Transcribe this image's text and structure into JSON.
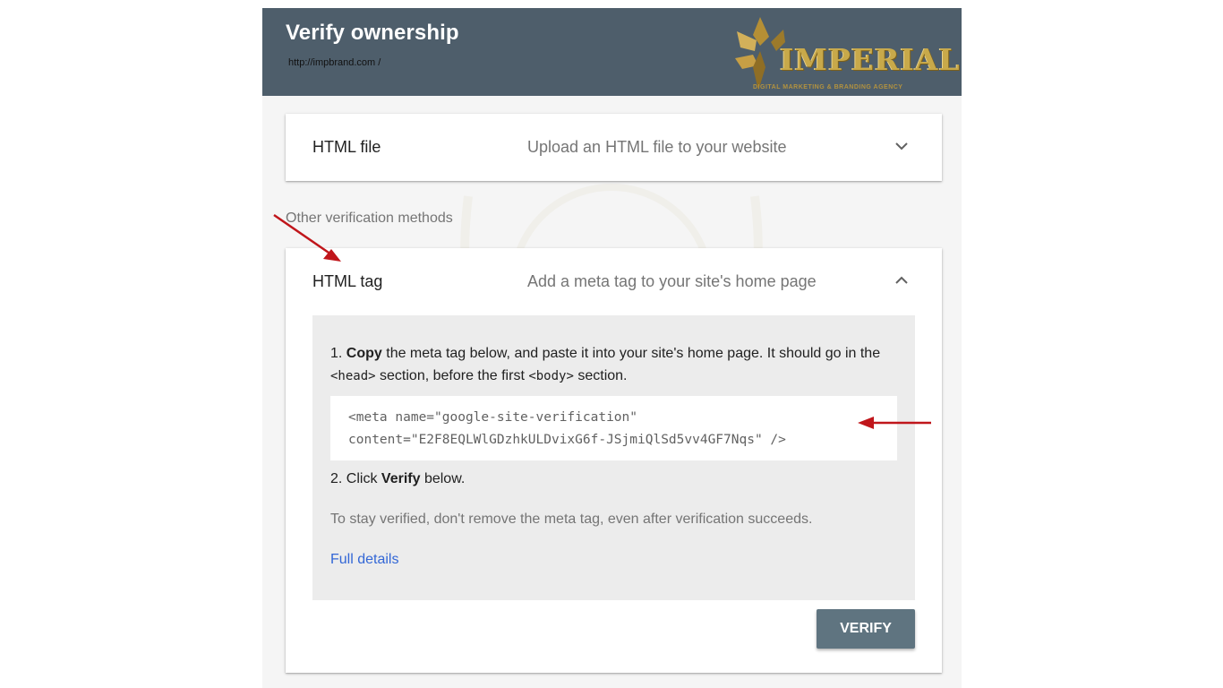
{
  "header": {
    "title": "Verify ownership",
    "url": "http://impbrand.com /",
    "logo": {
      "name": "IMPERIAL",
      "tagline": "DIGITAL MARKETING & BRANDING AGENCY",
      "color": "#c8a94a"
    },
    "background_color": "#4e5e6b"
  },
  "html_file": {
    "title": "HTML file",
    "description": "Upload an HTML file to your website",
    "toggle_icon": "chevron-down-icon"
  },
  "other_methods_label": "Other verification methods",
  "html_tag": {
    "title": "HTML tag",
    "description": "Add a meta tag to your site's home page",
    "toggle_icon": "chevron-up-icon",
    "step1": {
      "prefix": "1. ",
      "bold": "Copy",
      "text_a": " the meta tag below, and paste it into your site's home page. It should go in the ",
      "code_head": "<head>",
      "text_b": " section, before the first ",
      "code_body": "<body>",
      "text_c": " section."
    },
    "meta_tag_line1": "<meta name=\"google-site-verification\"",
    "meta_tag_line2": "content=\"E2F8EQLWlGDzhkULDvixG6f-JSjmiQlSd5vv4GF7Nqs\" />",
    "step2": {
      "prefix": "2. Click ",
      "bold": "Verify",
      "suffix": " below."
    },
    "note": "To stay verified, don't remove the meta tag, even after verification succeeds.",
    "details_link": "Full details",
    "verify_button": "VERIFY"
  },
  "colors": {
    "annotation_arrow": "#c0161b",
    "link": "#3367d6",
    "button": "#5f7480"
  }
}
